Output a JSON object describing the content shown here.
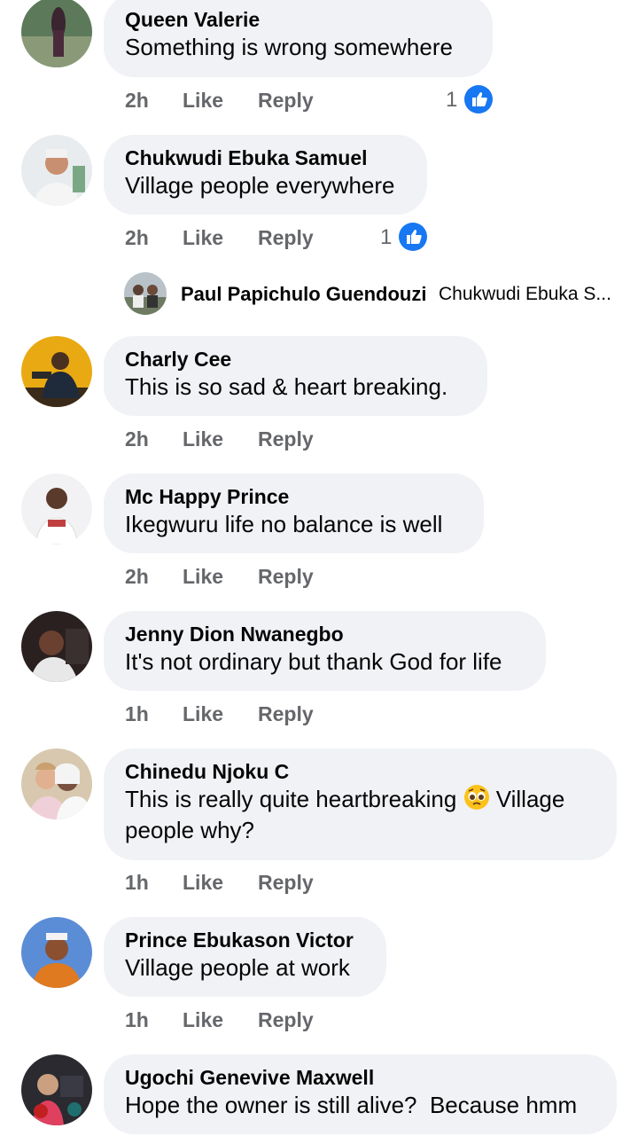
{
  "actions": {
    "like": "Like",
    "reply": "Reply"
  },
  "colors": {
    "bubble": "#f0f2f5",
    "like_blue": "#1877f2",
    "meta_gray": "#65676b"
  },
  "comments": [
    {
      "name": "Queen Valerie",
      "text": "Something is wrong somewhere",
      "time": "2h",
      "likes": "1"
    },
    {
      "name": "Chukwudi Ebuka Samuel",
      "text": "Village people everywhere",
      "time": "2h",
      "likes": "1"
    },
    {
      "name": "Charly Cee",
      "text": "This is so sad & heart breaking.",
      "time": "2h"
    },
    {
      "name": "Mc Happy Prince",
      "text": "Ikegwuru life no balance is well",
      "time": "2h"
    },
    {
      "name": "Jenny Dion Nwanegbo",
      "text": "It's not ordinary but thank God for life",
      "time": "1h"
    },
    {
      "name": "Chinedu Njoku C",
      "text_line1": "This is really quite heartbreaking",
      "emoji": "pleading-face",
      "text_line1_end": " Village",
      "text_line2": "people why?",
      "time": "1h"
    },
    {
      "name": "Prince Ebukason Victor",
      "text": "Village people at work",
      "time": "1h"
    },
    {
      "name": "Ugochi Genevive Maxwell",
      "text": "Hope the owner is still alive?  Because hmm"
    }
  ],
  "reply_preview": {
    "name": "Paul Papichulo Guendouzi",
    "snippet": "Chukwudi Ebuka S..."
  }
}
